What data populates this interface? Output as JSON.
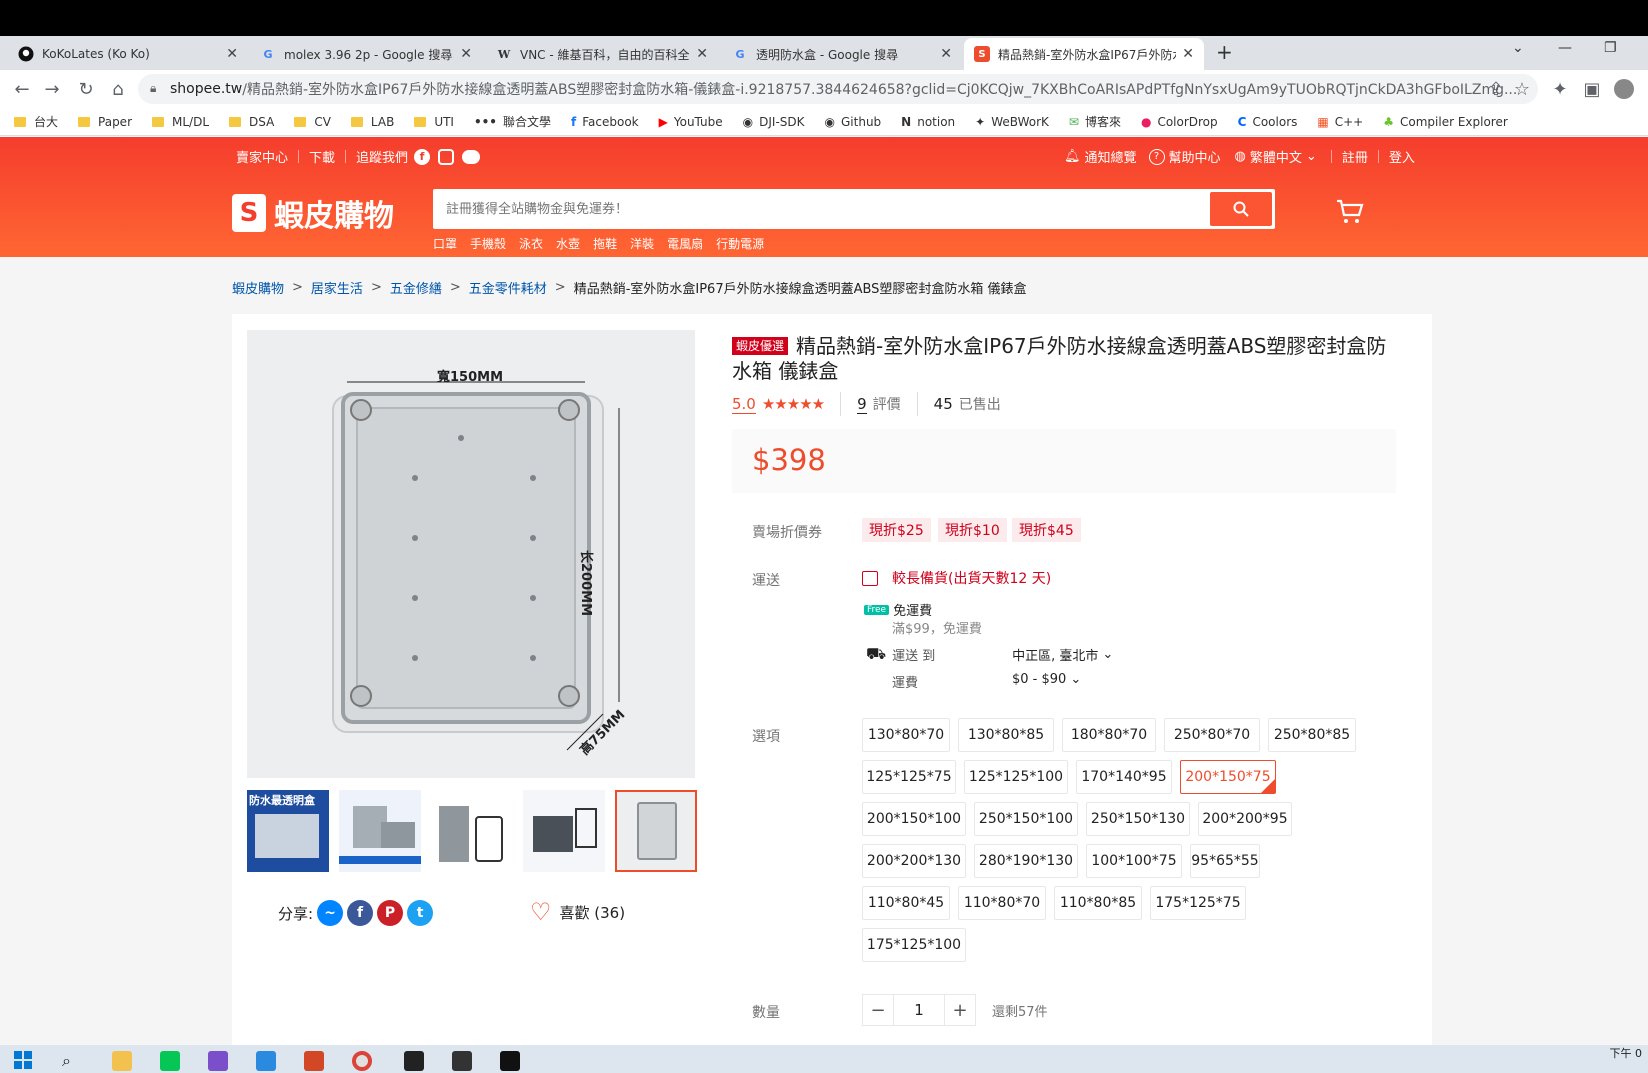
{
  "browser": {
    "tabs": [
      {
        "title": "KoKoLates (Ko Ko)",
        "icon": "github-icon"
      },
      {
        "title": "molex 3.96 2p - Google 搜尋",
        "icon": "google-icon"
      },
      {
        "title": "VNC - 維基百科，自由的百科全書",
        "icon": "wikipedia-icon"
      },
      {
        "title": "透明防水盒 - Google 搜尋",
        "icon": "google-icon"
      },
      {
        "title": "精品熱銷-室外防水盒IP67戶外防水",
        "icon": "shopee-icon"
      }
    ],
    "new_tab": "+",
    "url_domain": "shopee.tw",
    "url_path": "/精品熱銷-室外防水盒IP67戶外防水接線盒透明蓋ABS塑膠密封盒防水箱-儀錶盒-i.9218757.3844624658?gclid=Cj0KCQjw_7KXBhCoARIsAPdPTfgNnYsxUgAm9yTUObRQTjnCkDA3hGFboILZmg...",
    "bookmarks": [
      {
        "label": "台大",
        "type": "folder"
      },
      {
        "label": "Paper",
        "type": "folder"
      },
      {
        "label": "ML/DL",
        "type": "folder"
      },
      {
        "label": "DSA",
        "type": "folder"
      },
      {
        "label": "CV",
        "type": "folder"
      },
      {
        "label": "LAB",
        "type": "folder"
      },
      {
        "label": "UTI",
        "type": "folder"
      },
      {
        "label": "聯合文學",
        "type": "site"
      },
      {
        "label": "Facebook",
        "type": "site"
      },
      {
        "label": "YouTube",
        "type": "site"
      },
      {
        "label": "DJI-SDK",
        "type": "site"
      },
      {
        "label": "Github",
        "type": "site"
      },
      {
        "label": "notion",
        "type": "site"
      },
      {
        "label": "WeBWorK",
        "type": "site"
      },
      {
        "label": "博客來",
        "type": "site"
      },
      {
        "label": "ColorDrop",
        "type": "site"
      },
      {
        "label": "Coolors",
        "type": "site"
      },
      {
        "label": "C++",
        "type": "site"
      },
      {
        "label": "Compiler Explorer",
        "type": "site"
      }
    ]
  },
  "shopee": {
    "topnav_left": [
      "賣家中心",
      "下載",
      "追蹤我們"
    ],
    "topnav_right": [
      "通知總覽",
      "幫助中心",
      "繁體中文",
      "註冊",
      "登入"
    ],
    "logo_text": "蝦皮購物",
    "search_placeholder": "註冊獲得全站購物金與免運券！",
    "hotwords": [
      "口罩",
      "手機殼",
      "泳衣",
      "水壺",
      "拖鞋",
      "洋裝",
      "電風扇",
      "行動電源"
    ],
    "accent": "#ee4d2d"
  },
  "breadcrumb": [
    "蝦皮購物",
    "居家生活",
    "五金修繕",
    "五金零件耗材",
    "精品熱銷-室外防水盒IP67戶外防水接線盒透明蓋ABS塑膠密封盒防水箱 儀錶盒"
  ],
  "product": {
    "badge": "蝦皮優選",
    "title": "精品熱銷-室外防水盒IP67戶外防水接線盒透明蓋ABS塑膠密封盒防水箱 儀錶盒",
    "rating": "5.0",
    "stars": "★★★★★",
    "reviews_count": "9",
    "reviews_label": "評價",
    "sold_count": "45",
    "sold_label": "已售出",
    "price": "$398",
    "image_labels": {
      "width": "寬150MM",
      "length": "长200MM",
      "height": "高75MM"
    },
    "voucher_label": "賣場折價券",
    "vouchers": [
      "現折$25",
      "現折$10",
      "現折$45"
    ],
    "shipping_label": "運送",
    "shipping_note": "較長備貨(出貨天數12 天)",
    "free_badge": "Free",
    "free_shipping": "免運費",
    "free_condition": "滿$99，免運費",
    "ship_to_label": "運送 到",
    "ship_to_value": "中正區, 臺北市",
    "ship_fee_label": "運費",
    "ship_fee_value": "$0 - $90",
    "options_label": "選項",
    "options": [
      "130*80*70",
      "130*80*85",
      "180*80*70",
      "250*80*70",
      "250*80*85",
      "125*125*75",
      "125*125*100",
      "170*140*95",
      "200*150*75",
      "200*150*100",
      "250*150*100",
      "250*150*130",
      "200*200*95",
      "200*200*130",
      "280*190*130",
      "100*100*75",
      "95*65*55",
      "110*80*45",
      "110*80*70",
      "110*80*85",
      "175*125*75",
      "175*125*100"
    ],
    "selected_option": "200*150*75",
    "quantity_label": "數量",
    "quantity": "1",
    "remaining": "還剩57件",
    "share_label": "分享:",
    "like_label": "喜歡 (36)",
    "thumb_caption": "防水最透明盒"
  },
  "taskbar": {
    "clock_line1": "下午 0"
  }
}
